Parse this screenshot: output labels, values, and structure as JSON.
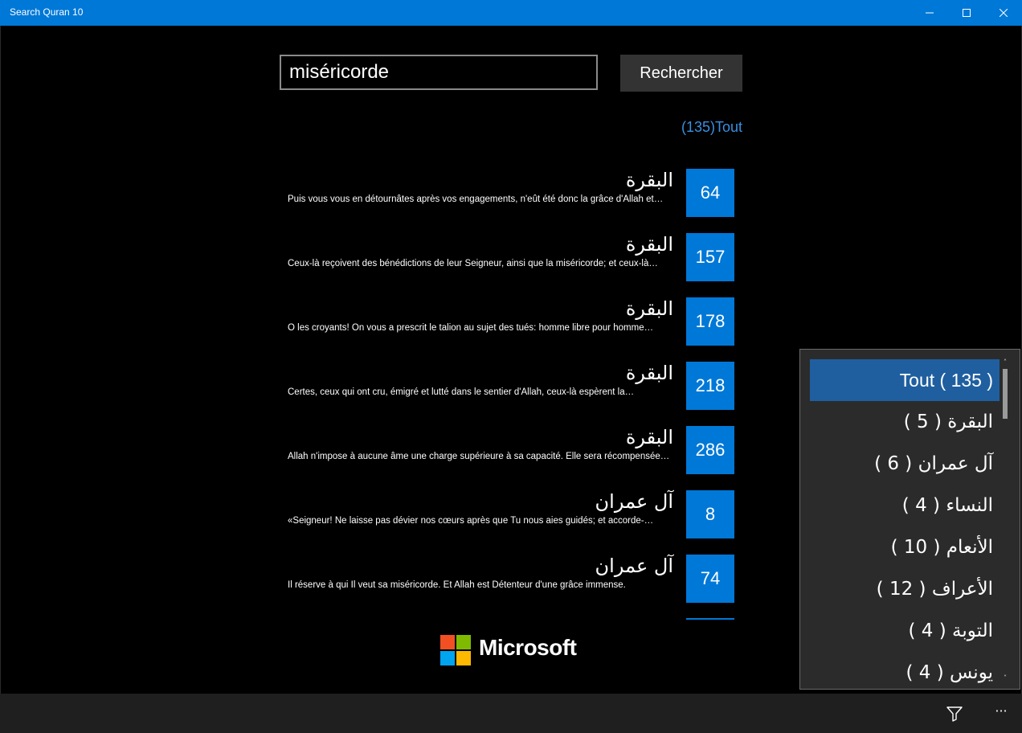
{
  "window": {
    "title": "Search Quran 10",
    "min_glyph": "—",
    "max_glyph": "☐",
    "close_glyph": "✕"
  },
  "search": {
    "value": "miséricorde",
    "button_label": "Rechercher",
    "filter_link": "(135)Tout"
  },
  "results": [
    {
      "surah": "البقرة",
      "text": "Puis vous vous en détournâtes après vos engagements, n'eût été donc la grâce d'Allah et…",
      "ayah": "64"
    },
    {
      "surah": "البقرة",
      "text": "Ceux-là reçoivent des bénédictions de leur Seigneur, ainsi que la miséricorde; et ceux-là…",
      "ayah": "157"
    },
    {
      "surah": "البقرة",
      "text": "O les croyants! On vous a prescrit le talion au sujet des tués: homme libre pour homme…",
      "ayah": "178"
    },
    {
      "surah": "البقرة",
      "text": "Certes, ceux qui ont cru, émigré et lutté dans le sentier d'Allah, ceux-là espèrent la…",
      "ayah": "218"
    },
    {
      "surah": "البقرة",
      "text": "Allah n'impose à aucune âme une charge supérieure à sa capacité. Elle sera récompensée…",
      "ayah": "286"
    },
    {
      "surah": "آل عمران",
      "text": "«Seigneur! Ne laisse pas dévier nos cœurs après que Tu nous aies guidés; et accorde-…",
      "ayah": "8"
    },
    {
      "surah": "آل عمران",
      "text": "Il réserve à qui Il veut sa miséricorde. Et Allah est Détenteur d'une grâce immense.",
      "ayah": "74"
    }
  ],
  "logo": {
    "wordmark": "Microsoft",
    "colors": [
      "#f25022",
      "#7fba00",
      "#00a4ef",
      "#ffb900"
    ]
  },
  "flyout": {
    "items": [
      {
        "label": "Tout ( 135 )",
        "selected": true
      },
      {
        "label": "البقرة ( 5 )"
      },
      {
        "label": "آل عمران ( 6 )"
      },
      {
        "label": "النساء ( 4 )"
      },
      {
        "label": "الأنعام ( 10 )"
      },
      {
        "label": "الأعراف ( 12 )"
      },
      {
        "label": "التوبة ( 4 )"
      },
      {
        "label": "يونس ( 4 )"
      }
    ],
    "scroll_up_glyph": "˄",
    "scroll_down_glyph": "˅"
  },
  "cmdbar": {
    "more_glyph": "···",
    "icons": [
      "filter-icon",
      "more-icon"
    ]
  },
  "colors": {
    "accent": "#0078d7",
    "link": "#3a8fe0",
    "selected": "#1f5fa0"
  }
}
